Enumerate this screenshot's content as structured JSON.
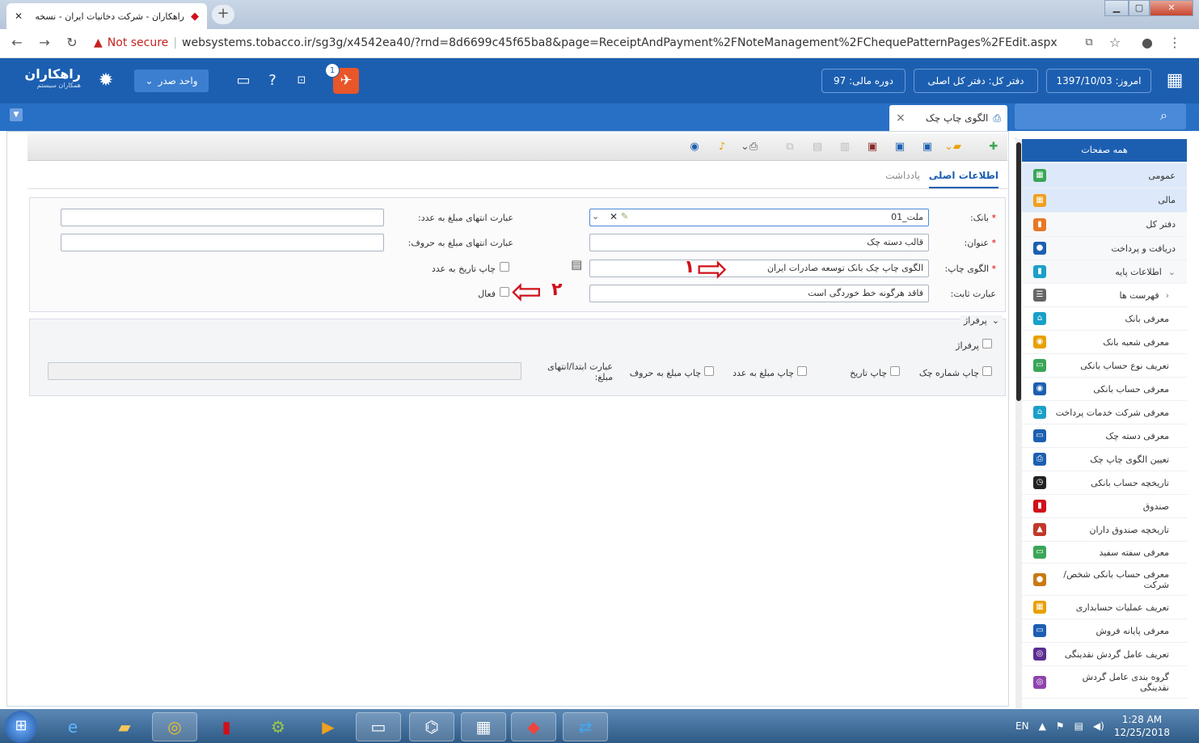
{
  "browser": {
    "tab_title": "راهکاران - شرکت دخانیات ایران - نسخه",
    "new_tab": "+",
    "not_secure": "Not secure",
    "url": "websystems.tobacco.ir/sg3g/x4542ea40/?rnd=8d6699c45f65ba8&page=ReceiptAndPayment%2FNoteManagement%2FChequePatternPages%2FEdit.aspx"
  },
  "header": {
    "logo_name": "راهکاران",
    "logo_sub": "همکاران سیستم",
    "unit": "واحد صدر",
    "notification_count": "1",
    "date": "امروز: 1397/10/03",
    "ledger": "دفتر کل: دفتر کل اصلی",
    "fiscal_period": "دوره مالی: 97"
  },
  "page_tab": {
    "title": "الگوی چاپ چک",
    "close": "×"
  },
  "form_tabs": {
    "main": "اطلاعات اصلی",
    "note": "یادداشت"
  },
  "form": {
    "bank_label": "بانک:",
    "bank_value": "ملت_01",
    "title_label": "عنوان:",
    "title_value": "قالب دسته چک",
    "pattern_label": "الگوی چاپ:",
    "pattern_value": "الگوی چاپ چک بانک توسعه صادرات ایران",
    "fixed_label": "عبارت ثابت:",
    "fixed_value": "فاقد هرگونه خط خوردگی است",
    "end_num_label": "عبارت انتهای مبلغ به عدد:",
    "end_text_label": "عبارت انتهای مبلغ به حروف:",
    "print_date_num": "چاپ تاریخ به عدد",
    "active": "فعال",
    "marker1": "۱",
    "marker2": "۲"
  },
  "perforation": {
    "legend": "پرفراژ",
    "perforation_cb": "پرفراژ",
    "print_number": "چاپ شماره چک",
    "print_date": "چاپ تاریخ",
    "print_amount_num": "چاپ مبلغ به عدد",
    "print_amount_text": "چاپ مبلغ به حروف",
    "start_end_label": "عبارت ابتدا/انتهای مبلغ:"
  },
  "sidebar": {
    "header": "همه صفحات",
    "items": [
      {
        "label": "عمومی",
        "color": "#3aa657"
      },
      {
        "label": "مالی",
        "color": "#f0a020"
      },
      {
        "label": "دفتر کل",
        "color": "#e87722"
      },
      {
        "label": "دریافت و پرداخت",
        "color": "#1c5fb1"
      },
      {
        "label": "اطلاعات پایه",
        "color": "#1aa0c8"
      },
      {
        "label": "فهرست ها",
        "color": "#666666"
      },
      {
        "label": "معرفی بانک",
        "color": "#1aa0c8"
      },
      {
        "label": "معرفی شعبه بانک",
        "color": "#e8a000"
      },
      {
        "label": "تعریف نوع حساب بانکی",
        "color": "#3aa657"
      },
      {
        "label": "معرفی حساب بانکی",
        "color": "#1c5fb1"
      },
      {
        "label": "معرفی شرکت خدمات پرداخت",
        "color": "#1aa0c8"
      },
      {
        "label": "معرفی دسته چک",
        "color": "#1c5fb1"
      },
      {
        "label": "تعیین الگوی چاپ چک",
        "color": "#1c5fb1"
      },
      {
        "label": "تاریخچه حساب بانکی",
        "color": "#222222"
      },
      {
        "label": "صندوق",
        "color": "#d0101a"
      },
      {
        "label": "تاریخچه صندوق داران",
        "color": "#c0392b"
      },
      {
        "label": "معرفی سفته سفید",
        "color": "#3aa657"
      },
      {
        "label": "معرفی حساب بانکی شخص/ شرکت",
        "color": "#c87a10"
      },
      {
        "label": "تعریف عملیات حسابداری",
        "color": "#e8a000"
      },
      {
        "label": "معرفی پایانه فروش",
        "color": "#1c5fb1"
      },
      {
        "label": "تعریف عامل گردش نقدینگی",
        "color": "#5b2e91"
      },
      {
        "label": "گروه بندی عامل گردش نقدینگی",
        "color": "#8e44ad"
      }
    ]
  },
  "taskbar": {
    "lang": "EN",
    "time": "1:28 AM",
    "date": "12/25/2018"
  }
}
